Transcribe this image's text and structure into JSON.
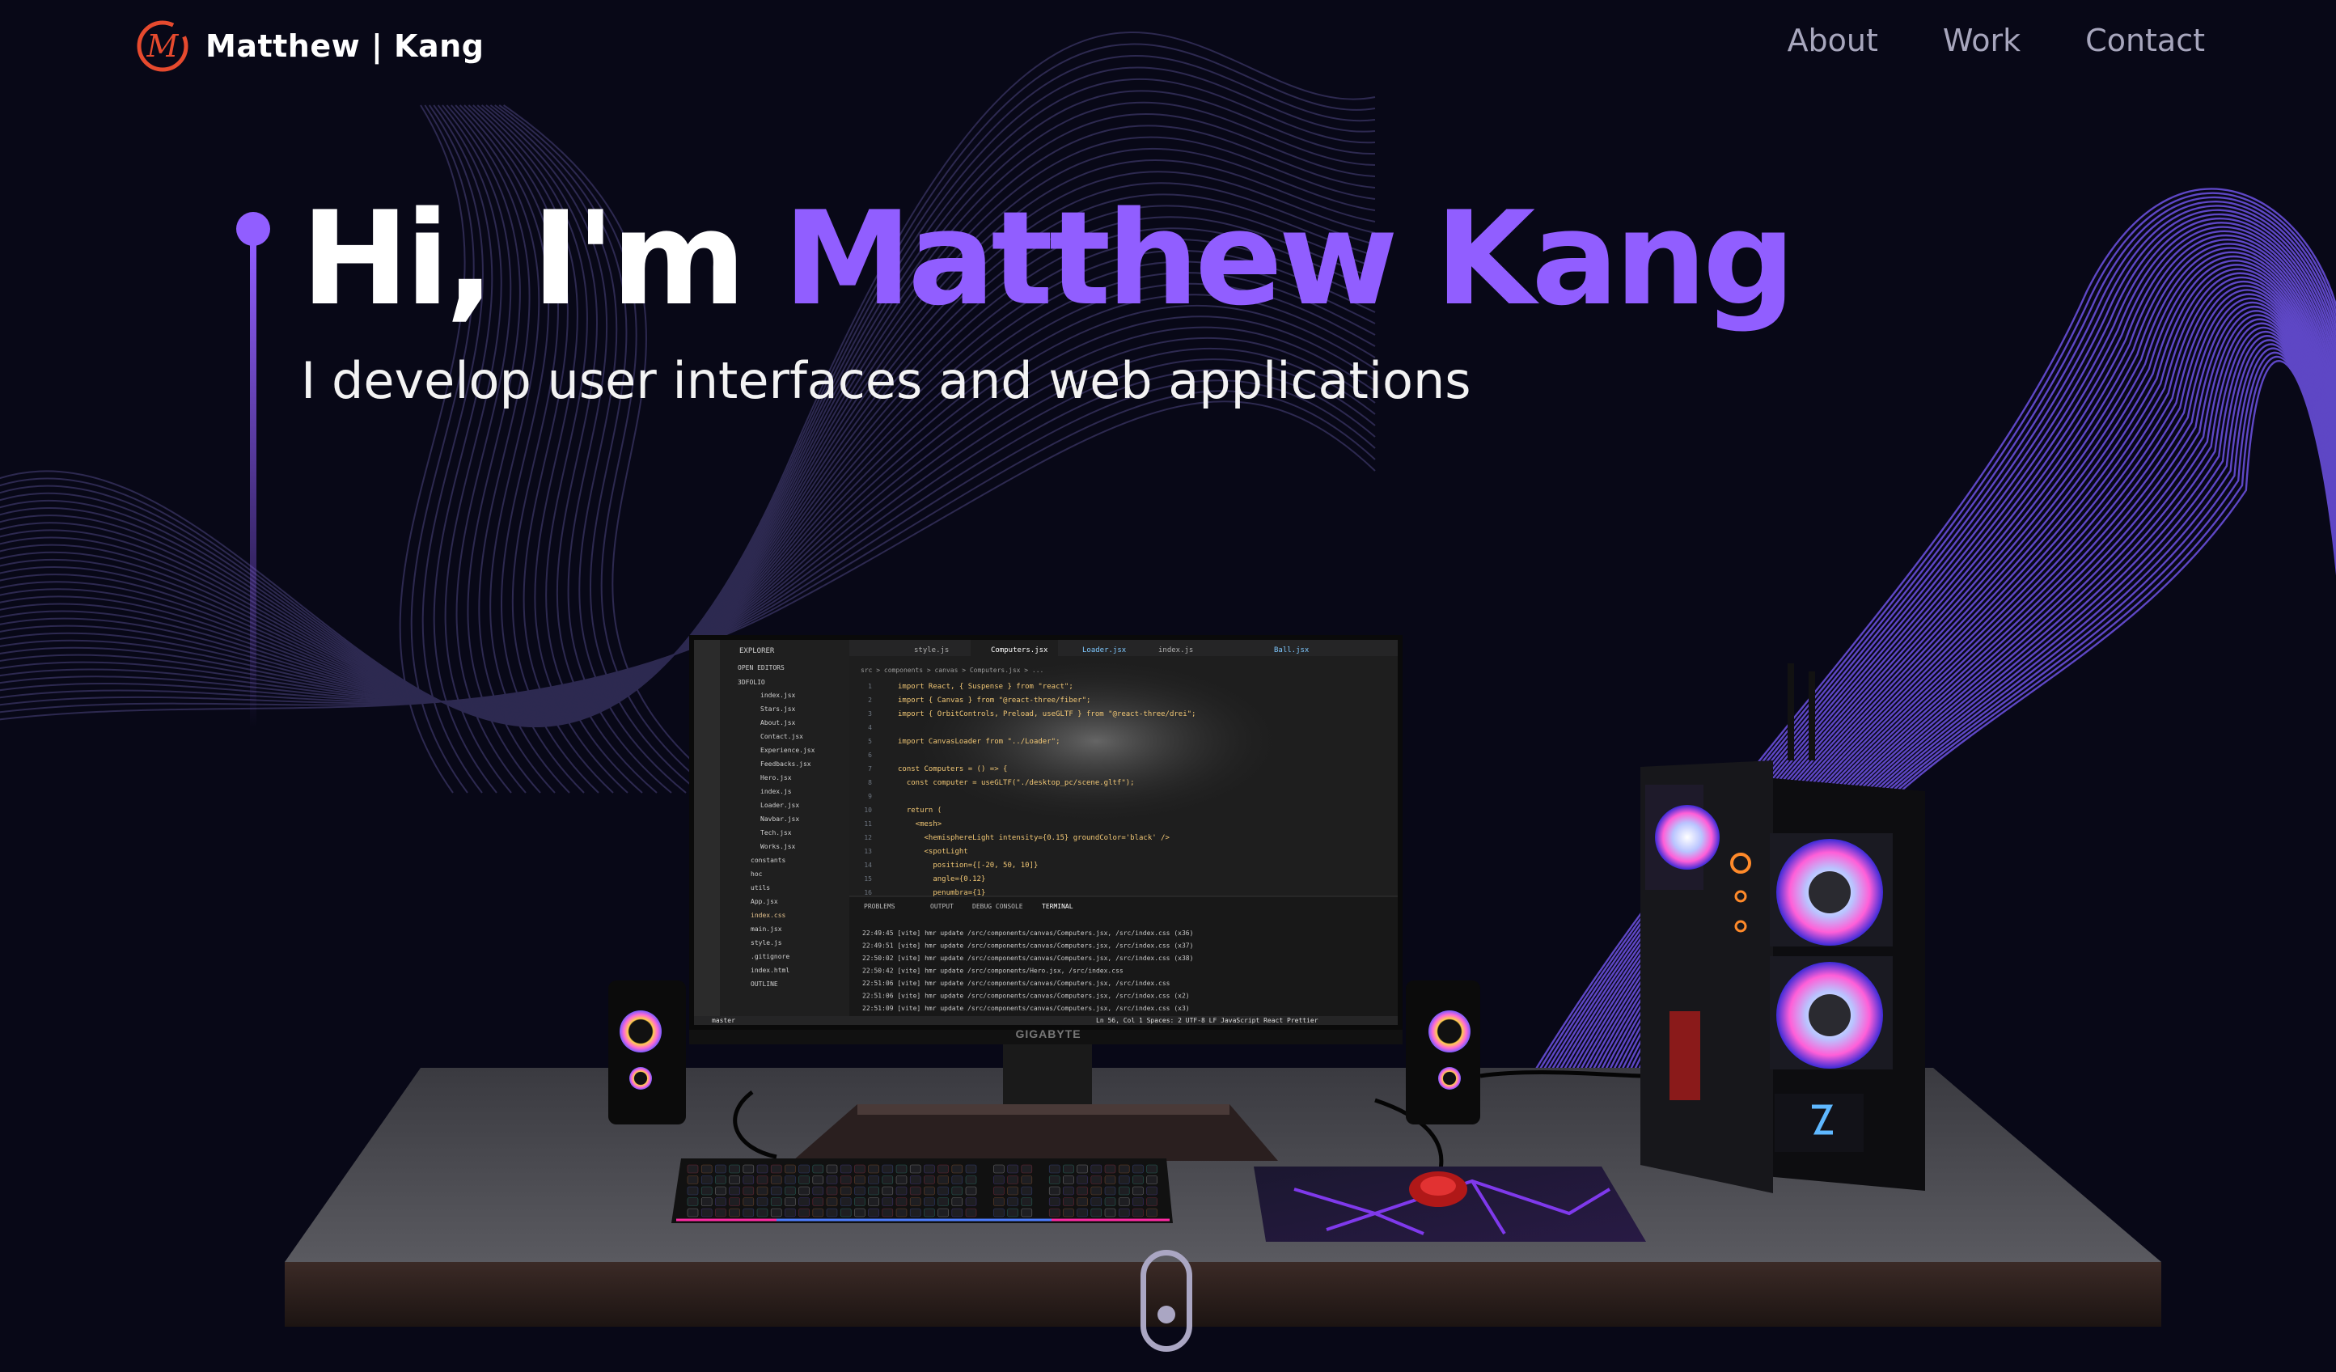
{
  "navbar": {
    "logo_letter": "M",
    "brand": "Matthew | Kang",
    "links": [
      "About",
      "Work",
      "Contact"
    ]
  },
  "hero": {
    "greeting": "Hi, I'm ",
    "name": "Matthew Kang",
    "subtitle": "I develop user interfaces and web applications"
  },
  "monitor": {
    "brand_label": "GIGABYTE",
    "explorer_title": "EXPLORER",
    "explorer_sections": [
      "OPEN EDITORS",
      "3DFOLIO"
    ],
    "files": [
      "index.jsx",
      "Stars.jsx",
      "About.jsx",
      "Contact.jsx",
      "Experience.jsx",
      "Feedbacks.jsx",
      "Hero.jsx",
      "index.js",
      "Loader.jsx",
      "Navbar.jsx",
      "Tech.jsx",
      "Works.jsx",
      "constants",
      "hoc",
      "utils",
      "App.jsx",
      "index.css",
      "main.jsx",
      "style.js",
      ".gitignore",
      "index.html",
      "OUTLINE"
    ],
    "tabs": [
      "style.js",
      "Computers.jsx",
      "Loader.jsx",
      "index.js",
      "Ball.jsx"
    ],
    "breadcrumb": "src > components > canvas > Computers.jsx > ...",
    "code_lines": [
      "import React, { Suspense } from \"react\";",
      "import { Canvas } from \"@react-three/fiber\";",
      "import { OrbitControls, Preload, useGLTF } from \"@react-three/drei\";",
      "",
      "import CanvasLoader from \"../Loader\";",
      "",
      "const Computers = () => {",
      "  const computer = useGLTF(\"./desktop_pc/scene.gltf\");",
      "",
      "  return (",
      "    <mesh>",
      "      <hemisphereLight intensity={0.15} groundColor='black' />",
      "      <spotLight",
      "        position={[-20, 50, 10]}",
      "        angle={0.12}",
      "        penumbra={1}"
    ],
    "panel_tabs": [
      "PROBLEMS",
      "OUTPUT",
      "DEBUG CONSOLE",
      "TERMINAL"
    ],
    "terminal_lines": [
      "22:49:45 [vite] hmr update /src/components/canvas/Computers.jsx, /src/index.css (x36)",
      "22:49:51 [vite] hmr update /src/components/canvas/Computers.jsx, /src/index.css (x37)",
      "22:50:02 [vite] hmr update /src/components/canvas/Computers.jsx, /src/index.css (x38)",
      "22:50:42 [vite] hmr update /src/components/Hero.jsx, /src/index.css",
      "22:51:06 [vite] hmr update /src/components/canvas/Computers.jsx, /src/index.css",
      "22:51:06 [vite] hmr update /src/components/canvas/Computers.jsx, /src/index.css (x2)",
      "22:51:09 [vite] hmr update /src/components/canvas/Computers.jsx, /src/index.css (x3)"
    ],
    "status_left": "master",
    "status_right": "Ln 56, Col 1   Spaces: 2   UTF-8   LF   JavaScript React   Prettier"
  },
  "colors": {
    "accent": "#915eff",
    "background": "#080817",
    "nav_link": "#a7a6bd",
    "logo": "#e64a2e"
  }
}
